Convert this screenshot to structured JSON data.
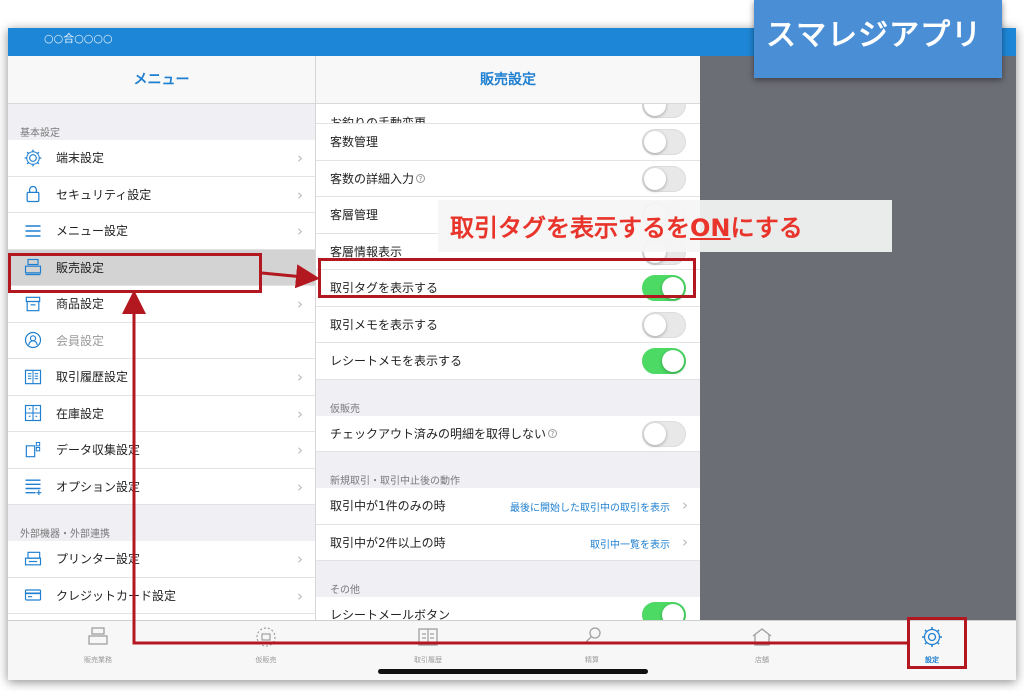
{
  "statusbar": {
    "company": "○○合○○○○"
  },
  "sidebar": {
    "title": "メニュー",
    "sections": [
      {
        "header": "基本設定",
        "items": [
          {
            "label": "端末設定",
            "icon": "gear-icon"
          },
          {
            "label": "セキュリティ設定",
            "icon": "lock-icon"
          },
          {
            "label": "メニュー設定",
            "icon": "menu-lines-icon"
          },
          {
            "label": "販売設定",
            "icon": "register-icon",
            "active": true
          },
          {
            "label": "商品設定",
            "icon": "box-icon"
          },
          {
            "label": "会員設定",
            "icon": "member-icon",
            "disabled": true
          },
          {
            "label": "取引履歴設定",
            "icon": "book-icon"
          },
          {
            "label": "在庫設定",
            "icon": "inventory-icon"
          },
          {
            "label": "データ収集設定",
            "icon": "data-collection-icon"
          },
          {
            "label": "オプション設定",
            "icon": "option-list-icon"
          }
        ]
      },
      {
        "header": "外部機器・外部連携",
        "items": [
          {
            "label": "プリンター設定",
            "icon": "printer-icon"
          },
          {
            "label": "クレジットカード設定",
            "icon": "credit-card-icon"
          }
        ]
      }
    ]
  },
  "main": {
    "title": "販売設定",
    "rows_top": [
      {
        "label": "お釣りの手動変更",
        "toggle": false,
        "partial": true
      },
      {
        "label": "客数管理",
        "toggle": false
      },
      {
        "label": "客数の詳細入力",
        "toggle": false,
        "help": "?"
      },
      {
        "label": "客層管理",
        "toggle": false
      },
      {
        "label": "客層情報表示",
        "toggle": false
      },
      {
        "label": "取引タグを表示する",
        "toggle": true
      },
      {
        "label": "取引メモを表示する",
        "toggle": false
      },
      {
        "label": "レシートメモを表示する",
        "toggle": true
      }
    ],
    "group_provisional": {
      "header": "仮販売",
      "rows": [
        {
          "label": "チェックアウト済みの明細を取得しない",
          "toggle": false,
          "help": "?"
        }
      ]
    },
    "group_after": {
      "header": "新規取引・取引中止後の動作",
      "rows": [
        {
          "label": "取引中が1件のみの時",
          "value": "最後に開始した取引中の取引を表示"
        },
        {
          "label": "取引中が2件以上の時",
          "value": "取引中一覧を表示"
        }
      ]
    },
    "group_other": {
      "header": "その他",
      "rows": [
        {
          "label": "レシートメールボタン",
          "toggle": true
        }
      ]
    }
  },
  "tabbar": {
    "tabs": [
      {
        "label": "販売業務",
        "icon": "register-icon"
      },
      {
        "label": "仮販売",
        "icon": "provisional-sale-icon"
      },
      {
        "label": "取引履歴",
        "icon": "book-icon"
      },
      {
        "label": "精算",
        "icon": "key-icon"
      },
      {
        "label": "店舗",
        "icon": "store-icon"
      },
      {
        "label": "設定",
        "icon": "gear-icon",
        "active": true
      }
    ]
  },
  "annotation": {
    "brand": "スマレジアプリ",
    "callout_before": "取引タグを表示するを",
    "callout_on": "ON",
    "callout_after": "にする"
  },
  "colors": {
    "accent": "#1f7fd0",
    "statusbar": "#1e86d6",
    "toggle_on": "#4cd964",
    "highlight": "#b3171f",
    "callout_text": "#e8342a",
    "brand_badge": "#4a8fd6"
  }
}
